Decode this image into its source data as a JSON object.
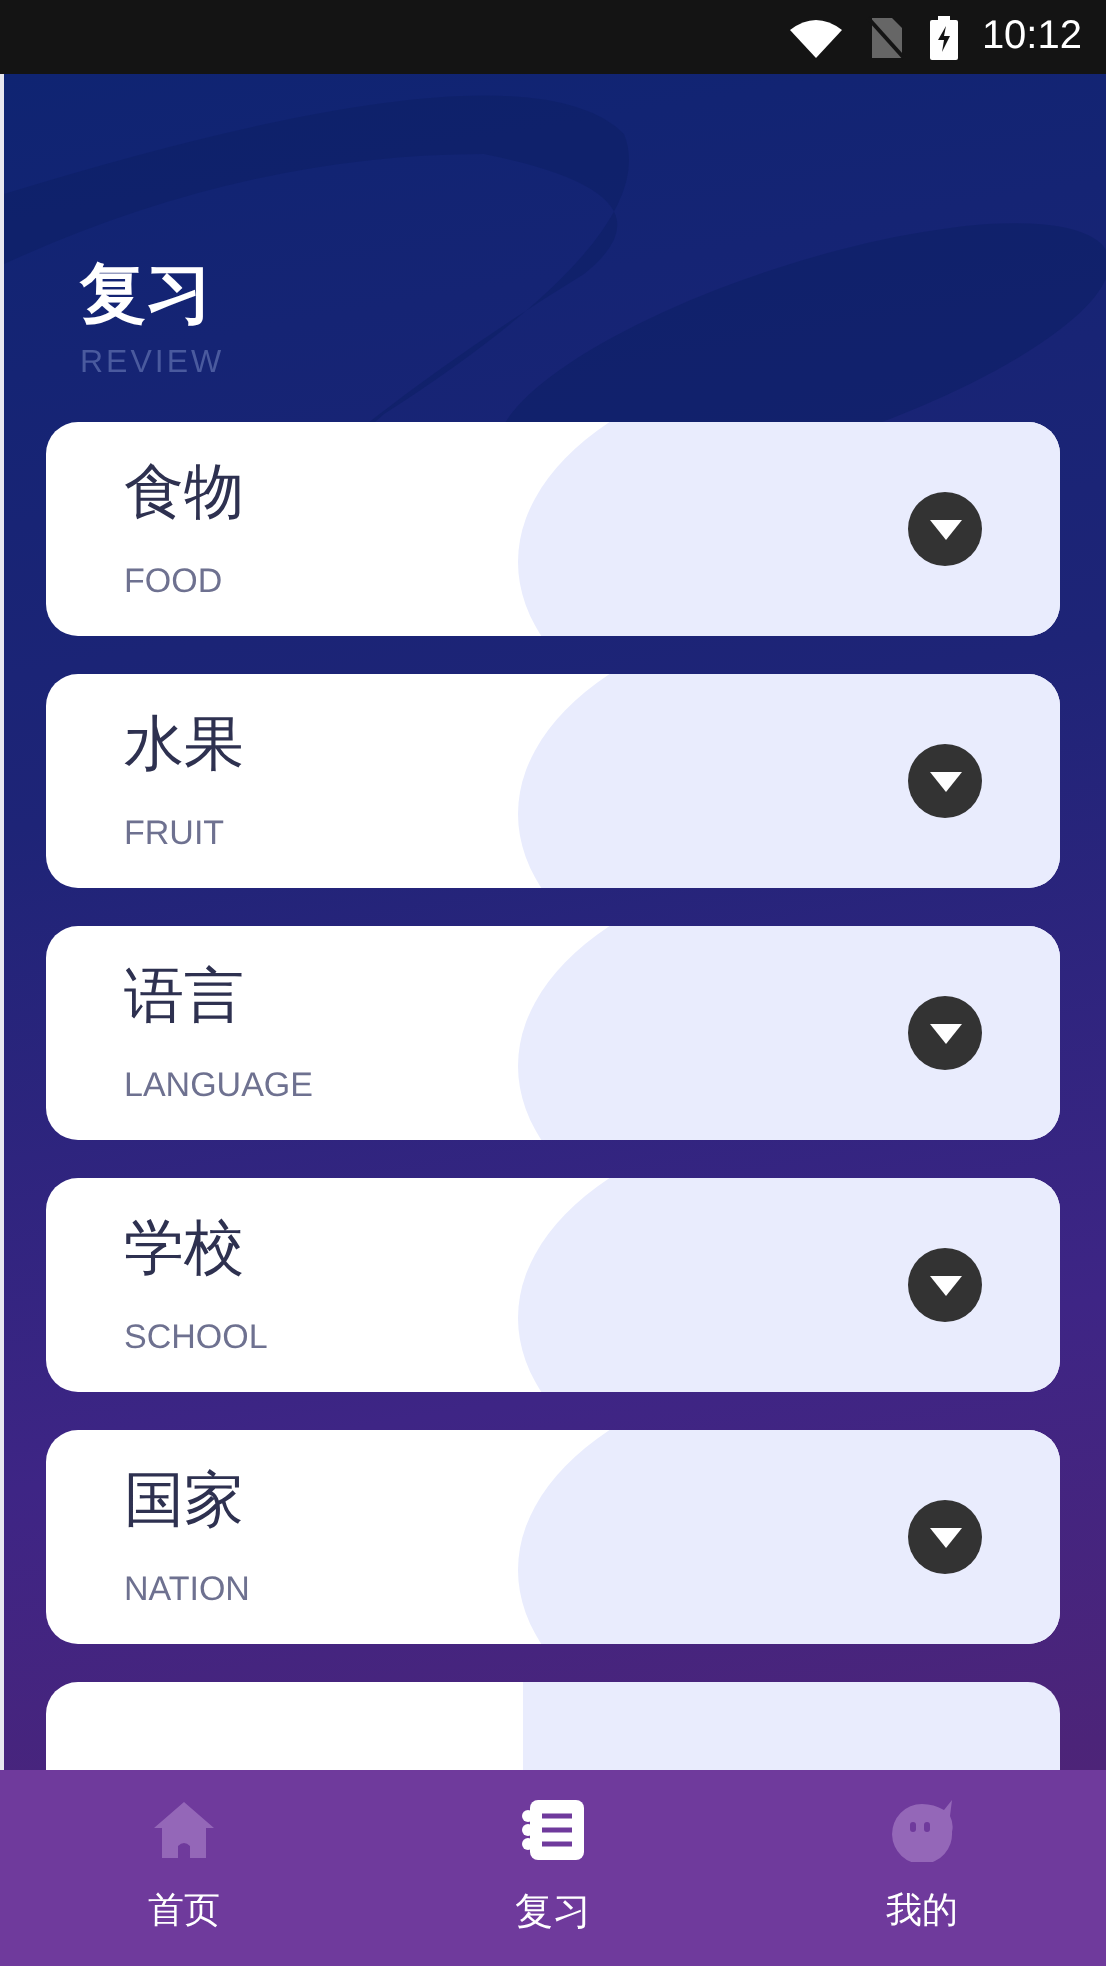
{
  "status_bar": {
    "time": "10:12"
  },
  "header": {
    "title": "复习",
    "subtitle": "REVIEW"
  },
  "categories": [
    {
      "title": "食物",
      "subtitle": "FOOD",
      "expanded": false
    },
    {
      "title": "水果",
      "subtitle": "FRUIT",
      "expanded": false
    },
    {
      "title": "语言",
      "subtitle": "LANGUAGE",
      "expanded": false
    },
    {
      "title": "学校",
      "subtitle": "SCHOOL",
      "expanded": false
    },
    {
      "title": "国家",
      "subtitle": "NATION",
      "expanded": false
    }
  ],
  "nav": [
    {
      "label": "首页",
      "kind": "home",
      "selected": false
    },
    {
      "label": "复习",
      "kind": "notebook",
      "selected": true
    },
    {
      "label": "我的",
      "kind": "face",
      "selected": false
    }
  ]
}
